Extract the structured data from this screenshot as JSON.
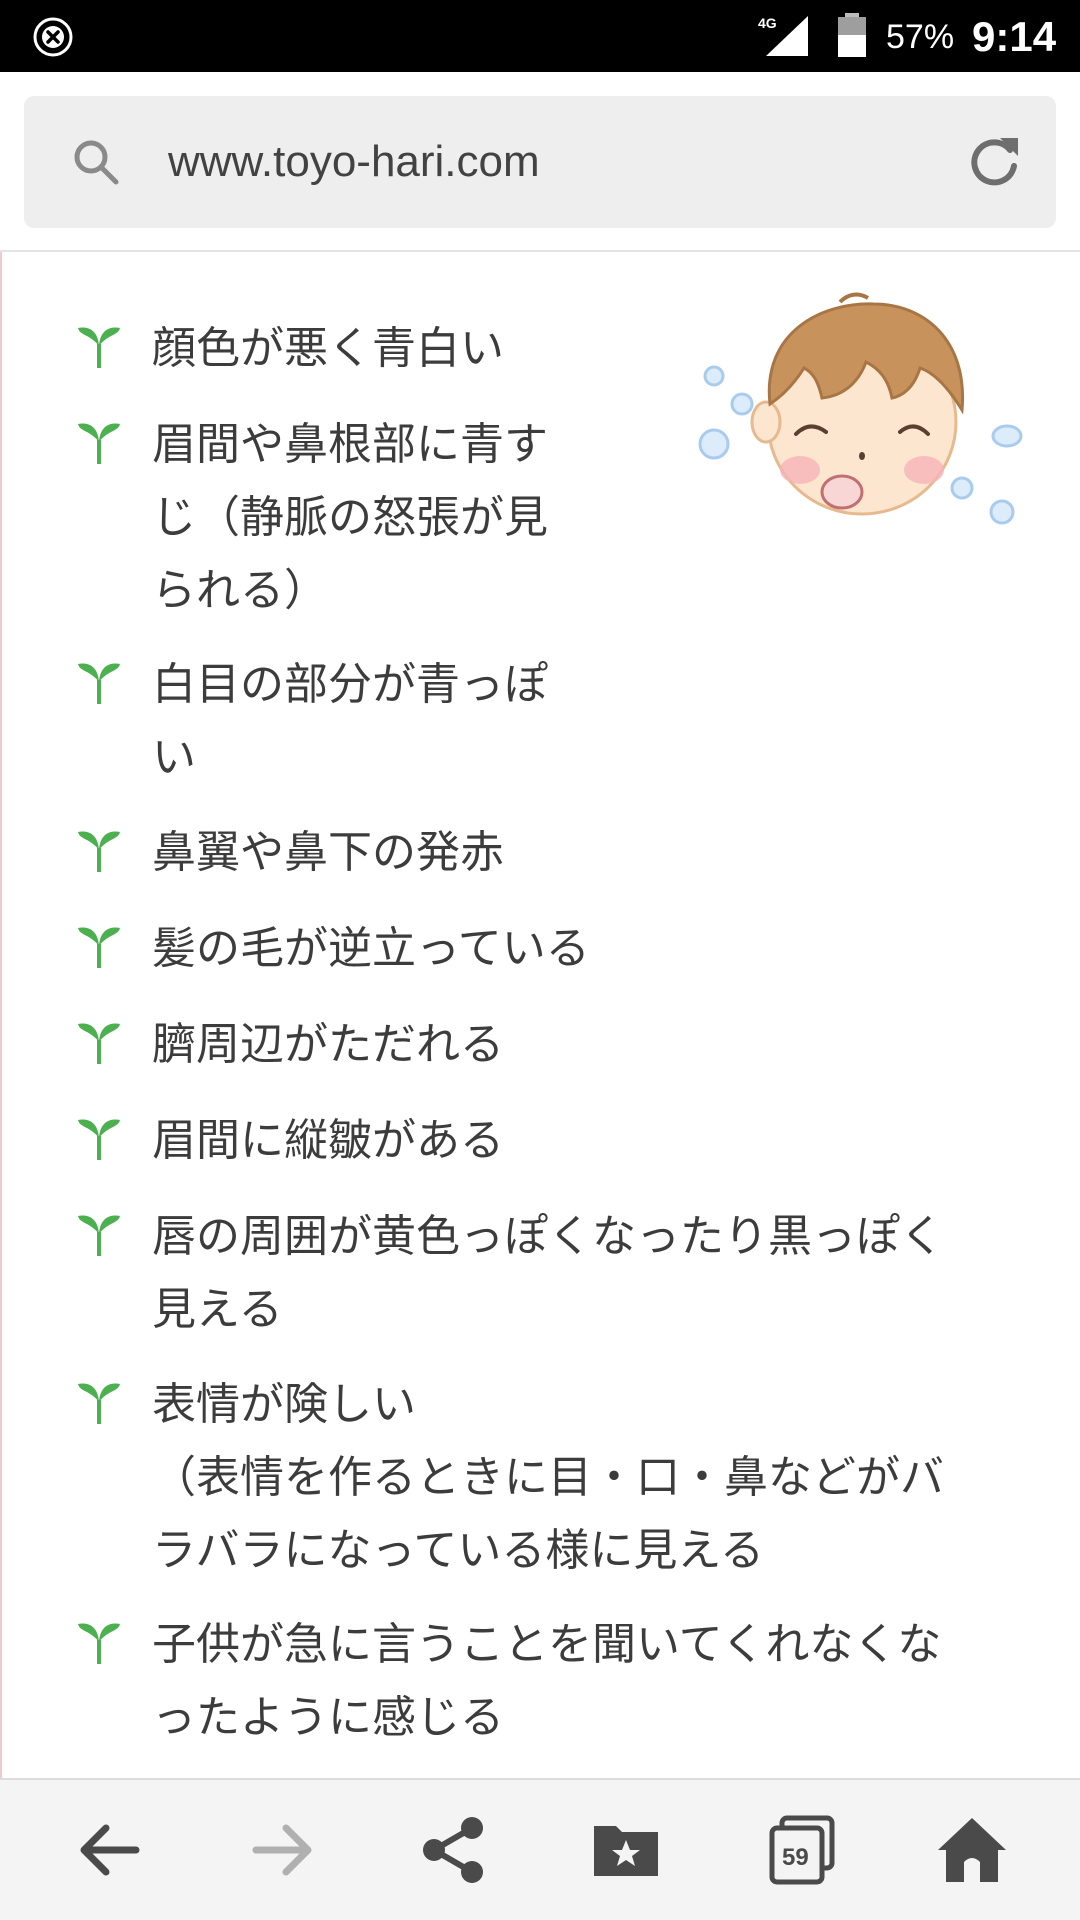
{
  "status_bar": {
    "network": "4G",
    "battery": "57%",
    "time": "9:14"
  },
  "address_bar": {
    "url": "www.toyo-hari.com"
  },
  "list": [
    {
      "text": "顔色が悪く青白い"
    },
    {
      "text": "眉間や鼻根部に青す\nじ（静脈の怒張が見\nられる）"
    },
    {
      "text": "白目の部分が青っぽ\nい"
    },
    {
      "text": "鼻翼や鼻下の発赤"
    },
    {
      "text": "髪の毛が逆立っている"
    },
    {
      "text": "臍周辺がただれる"
    },
    {
      "text": "眉間に縦皺がある"
    },
    {
      "text": "唇の周囲が黄色っぽくなったり黒っぽく\n見える"
    },
    {
      "text": "表情が険しい\n（表情を作るときに目・口・鼻などがバ\nラバラになっている様に見える"
    },
    {
      "text": "子供が急に言うことを聞いてくれなくな\nったように感じる"
    }
  ],
  "toolbar": {
    "tabs_count": "59"
  },
  "icons": {
    "bullet": "sprout-icon",
    "illustration": "crying-child-illustration"
  },
  "colors": {
    "bullet_green": "#4caf50",
    "text": "#3c3c3c",
    "status_bar": "#000000"
  }
}
